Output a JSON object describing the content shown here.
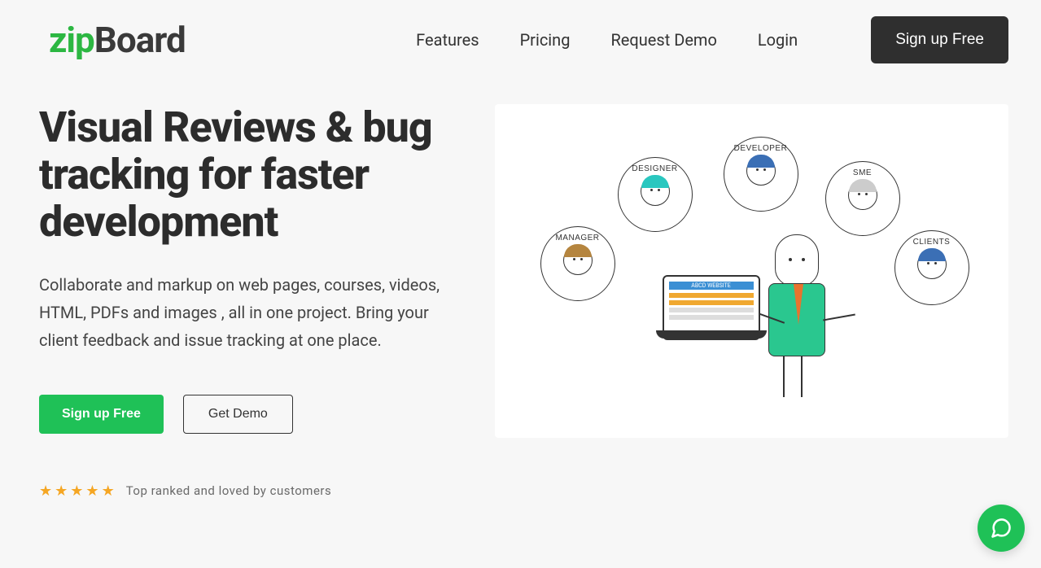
{
  "logo": {
    "part1": "zip",
    "part2": "Board"
  },
  "nav": {
    "features": "Features",
    "pricing": "Pricing",
    "request_demo": "Request Demo",
    "login": "Login",
    "signup": "Sign up Free"
  },
  "hero": {
    "title": "Visual Reviews & bug tracking for faster development",
    "subtitle": "Collaborate and markup on web pages, courses, videos, HTML, PDFs and images , all in one project. Bring your client feedback and issue tracking at one place.",
    "cta_primary": "Sign up Free",
    "cta_secondary": "Get Demo"
  },
  "rating": {
    "text": "Top ranked and loved by customers"
  },
  "illustration": {
    "roles": {
      "manager": "MANAGER",
      "designer": "DESIGNER",
      "developer": "DEVELOPER",
      "sme": "SME",
      "clients": "CLIENTS"
    },
    "screen_title": "ABCD WEBSITE"
  },
  "colors": {
    "brand_green": "#1fc157",
    "logo_green": "#2cb742",
    "dark": "#2f2f2f",
    "star": "#f5a623"
  }
}
